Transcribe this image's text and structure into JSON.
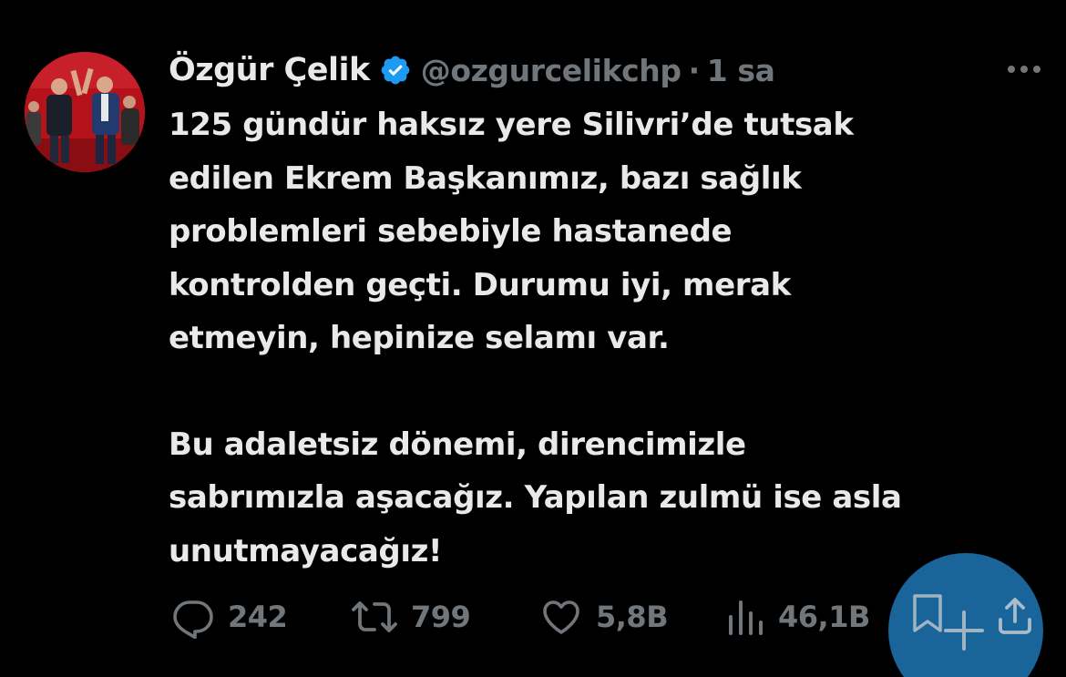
{
  "author": {
    "display_name": "Özgür Çelik",
    "handle": "@ozgurcelikchp",
    "separator": "·",
    "time": "1 sa",
    "verified_icon": "verified-badge-icon"
  },
  "tweet": {
    "paragraph1_lines": [
      "125 gündür haksız yere Silivri’de tutsak",
      "edilen Ekrem Başkanımız, bazı sağlık",
      "problemleri sebebiyle hastanede",
      "kontrolden geçti. Durumu iyi, merak",
      "etmeyin, hepinize selamı var."
    ],
    "paragraph2_lines": [
      "Bu adaletsiz dönemi, direncimizle",
      "sabrımızla aşacağız. Yapılan zulmü ise asla",
      "unutmayacağız!"
    ]
  },
  "actions": {
    "reply": {
      "icon": "reply-icon",
      "count": "242"
    },
    "retweet": {
      "icon": "retweet-icon",
      "count": "799"
    },
    "like": {
      "icon": "heart-icon",
      "count": "5,8B"
    },
    "views": {
      "icon": "views-chart-icon",
      "count": "46,1B"
    },
    "bookmark": {
      "icon": "bookmark-icon"
    },
    "share": {
      "icon": "share-icon"
    },
    "compose": {
      "icon": "compose-plus-icon"
    }
  },
  "colors": {
    "background": "#000000",
    "text": "#e7e9ea",
    "muted": "#71767b",
    "verified": "#1d9bf0",
    "fab": "#1d76b4"
  }
}
